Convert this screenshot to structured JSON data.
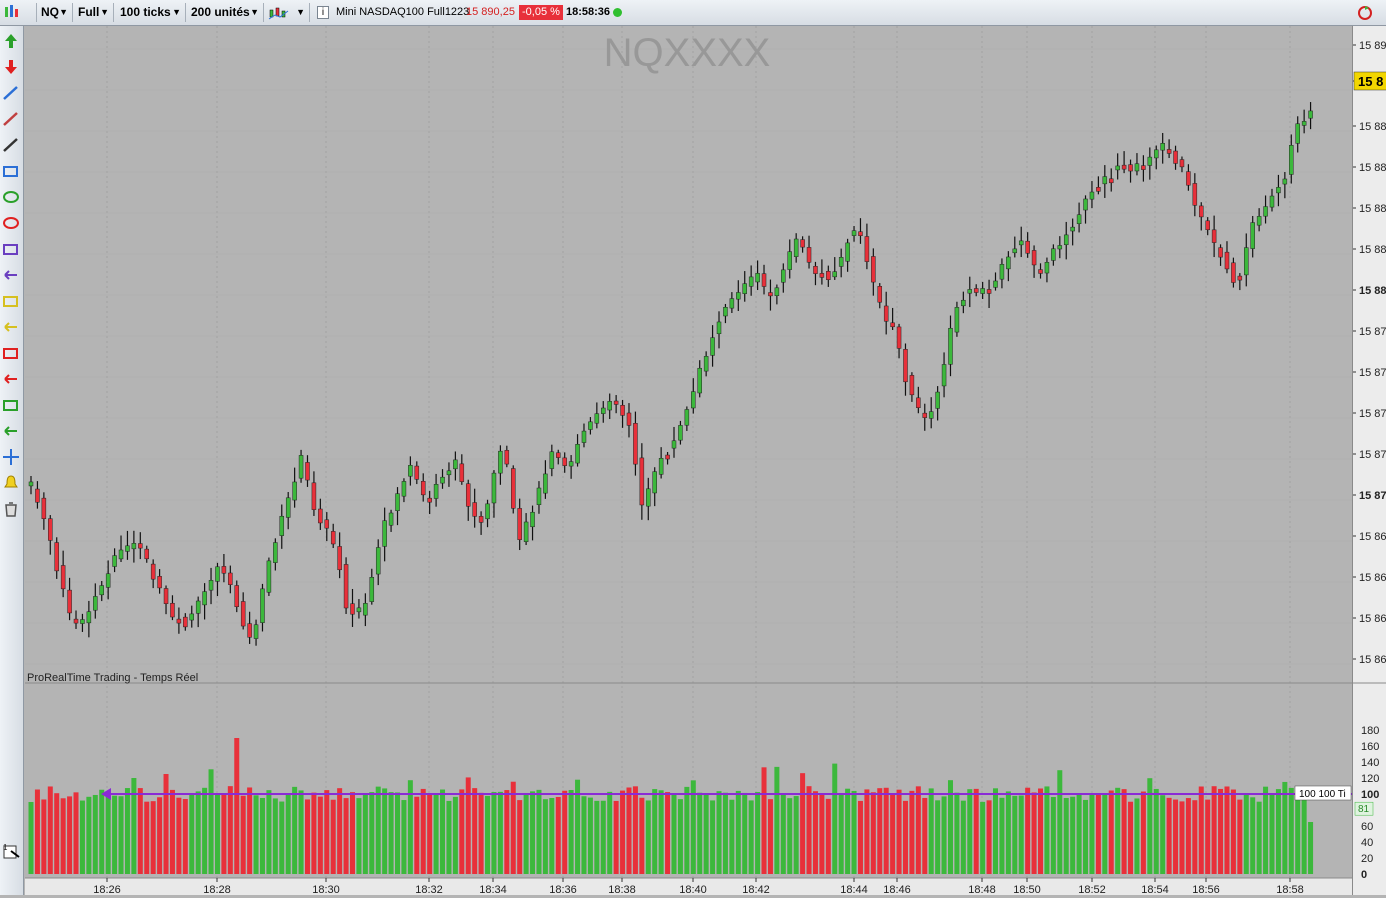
{
  "toolbar": {
    "symbol": "NQ",
    "view_mode": "Full",
    "interval": "100 ticks",
    "units": "200 unités",
    "instrument_name": "Mini NASDAQ100 Full1223",
    "last_price": "15 890,25",
    "change_pct": "-0,05 %",
    "clock": "18:58:36",
    "colors": {
      "down": "#e8303a",
      "up": "#3cb83c"
    }
  },
  "left_tools": [
    "buy-arrow-icon",
    "sell-arrow-icon",
    "fibonacci-icon",
    "ruler-icon",
    "trendline-icon",
    "rectangle-icon",
    "ellipse-green-icon",
    "ellipse-red-icon",
    "rectangle-order-icon",
    "arrow-left-purple-icon",
    "rectangle-yellow-icon",
    "arrow-left-yellow-icon",
    "rectangle-red-icon",
    "arrow-left-red-icon",
    "rectangle-green-icon",
    "arrow-left-green-icon",
    "move-icon",
    "alert-bell-icon",
    "trash-icon"
  ],
  "price_panel": {
    "watermark": "NQXXXX",
    "footer_label": "ProRealTime Trading - Temps Réel",
    "axis_labels": [
      "15 89",
      "15 8",
      "15 88",
      "15 88",
      "15 88",
      "15 88",
      "15 88",
      "15 87",
      "15 87",
      "15 87",
      "15 87",
      "15 87",
      "15 86",
      "15 86",
      "15 86",
      "15 86"
    ],
    "bold_axis_labels": [
      6,
      11
    ],
    "current_price_label": "15 8"
  },
  "volume_panel": {
    "axis_labels": [
      "180",
      "160",
      "140",
      "120",
      "100",
      "80",
      "60",
      "40",
      "20",
      "0"
    ],
    "current_volume_label": "81",
    "reference_line_label": "100 100 Ti",
    "reference_level": 100
  },
  "time_axis": [
    "18:26",
    "18:28",
    "18:30",
    "18:32",
    "18:34",
    "18:36",
    "18:38",
    "18:40",
    "18:42",
    "18:44",
    "18:46",
    "18:48",
    "18:50",
    "18:52",
    "18:54",
    "18:56",
    "18:58"
  ],
  "chart_data": {
    "type": "candlestick+volume",
    "num_bars": 200,
    "price_path": [
      [
        0,
        460
      ],
      [
        3,
        488
      ],
      [
        10,
        590
      ],
      [
        13,
        600
      ],
      [
        22,
        528
      ],
      [
        28,
        518
      ],
      [
        36,
        590
      ],
      [
        40,
        598
      ],
      [
        49,
        536
      ],
      [
        57,
        618
      ],
      [
        62,
        528
      ],
      [
        70,
        431
      ],
      [
        73,
        480
      ],
      [
        79,
        523
      ],
      [
        82,
        590
      ],
      [
        86,
        588
      ],
      [
        91,
        503
      ],
      [
        98,
        440
      ],
      [
        102,
        477
      ],
      [
        106,
        453
      ],
      [
        110,
        437
      ],
      [
        114,
        490
      ],
      [
        117,
        495
      ],
      [
        122,
        412
      ],
      [
        126,
        520
      ],
      [
        131,
        470
      ],
      [
        135,
        420
      ],
      [
        139,
        443
      ],
      [
        142,
        410
      ],
      [
        146,
        393
      ],
      [
        150,
        370
      ],
      [
        155,
        400
      ],
      [
        158,
        478
      ],
      [
        160,
        462
      ],
      [
        163,
        432
      ],
      [
        167,
        412
      ],
      [
        171,
        368
      ],
      [
        175,
        323
      ],
      [
        179,
        282
      ],
      [
        185,
        256
      ],
      [
        188,
        248
      ],
      [
        191,
        276
      ],
      [
        195,
        242
      ],
      [
        198,
        212
      ],
      [
        202,
        242
      ],
      [
        206,
        252
      ],
      [
        210,
        232
      ],
      [
        212,
        202
      ],
      [
        215,
        208
      ],
      [
        217,
        248
      ],
      [
        221,
        294
      ],
      [
        223,
        300
      ],
      [
        226,
        350
      ],
      [
        230,
        390
      ],
      [
        233,
        386
      ],
      [
        236,
        340
      ],
      [
        239,
        282
      ],
      [
        243,
        262
      ],
      [
        246,
        266
      ],
      [
        250,
        249
      ],
      [
        254,
        222
      ],
      [
        257,
        214
      ],
      [
        259,
        240
      ],
      [
        261,
        252
      ],
      [
        264,
        228
      ],
      [
        267,
        212
      ],
      [
        271,
        188
      ],
      [
        275,
        160
      ],
      [
        279,
        150
      ],
      [
        282,
        135
      ],
      [
        285,
        145
      ],
      [
        289,
        132
      ],
      [
        293,
        120
      ],
      [
        298,
        143
      ],
      [
        302,
        189
      ],
      [
        306,
        218
      ],
      [
        310,
        245
      ],
      [
        312,
        262
      ],
      [
        316,
        198
      ],
      [
        320,
        176
      ],
      [
        324,
        155
      ],
      [
        327,
        104
      ],
      [
        331,
        88
      ]
    ],
    "volume_avg_ref": 100
  }
}
